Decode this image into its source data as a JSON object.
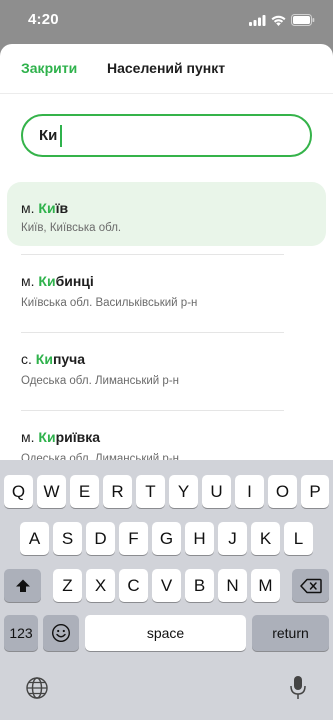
{
  "status_bar": {
    "time": "4:20"
  },
  "header": {
    "close_label": "Закрити",
    "title": "Населений пункт"
  },
  "search": {
    "value": "Ки"
  },
  "results": [
    {
      "prefix": "м. ",
      "match": "Ки",
      "rest": "їв",
      "region": "Київ, Київська обл.",
      "selected": true
    },
    {
      "prefix": "м. ",
      "match": "Ки",
      "rest": "бинці",
      "region": "Київська обл. Васильківський р-н"
    },
    {
      "prefix": "с. ",
      "match": "Ки",
      "rest": "пуча",
      "region": "Одеська обл. Лиманський р-н"
    },
    {
      "prefix": "м. ",
      "match": "Ки",
      "rest": "риївка",
      "region": "Одеська обл. Лиманський р-н"
    }
  ],
  "keyboard": {
    "row1": [
      "Q",
      "W",
      "E",
      "R",
      "T",
      "Y",
      "U",
      "I",
      "O",
      "P"
    ],
    "row2": [
      "A",
      "S",
      "D",
      "F",
      "G",
      "H",
      "J",
      "K",
      "L"
    ],
    "row3": [
      "Z",
      "X",
      "C",
      "V",
      "B",
      "N",
      "M"
    ],
    "numbers_label": "123",
    "space_label": "space",
    "return_label": "return"
  },
  "colors": {
    "accent": "#2fb24c",
    "selected_bg": "#e9f5e9",
    "keyboard_bg": "#d1d3d9"
  },
  "icons": [
    "signal-icon",
    "wifi-icon",
    "battery-icon",
    "shift-icon",
    "backspace-icon",
    "emoji-icon",
    "globe-icon",
    "microphone-icon"
  ]
}
